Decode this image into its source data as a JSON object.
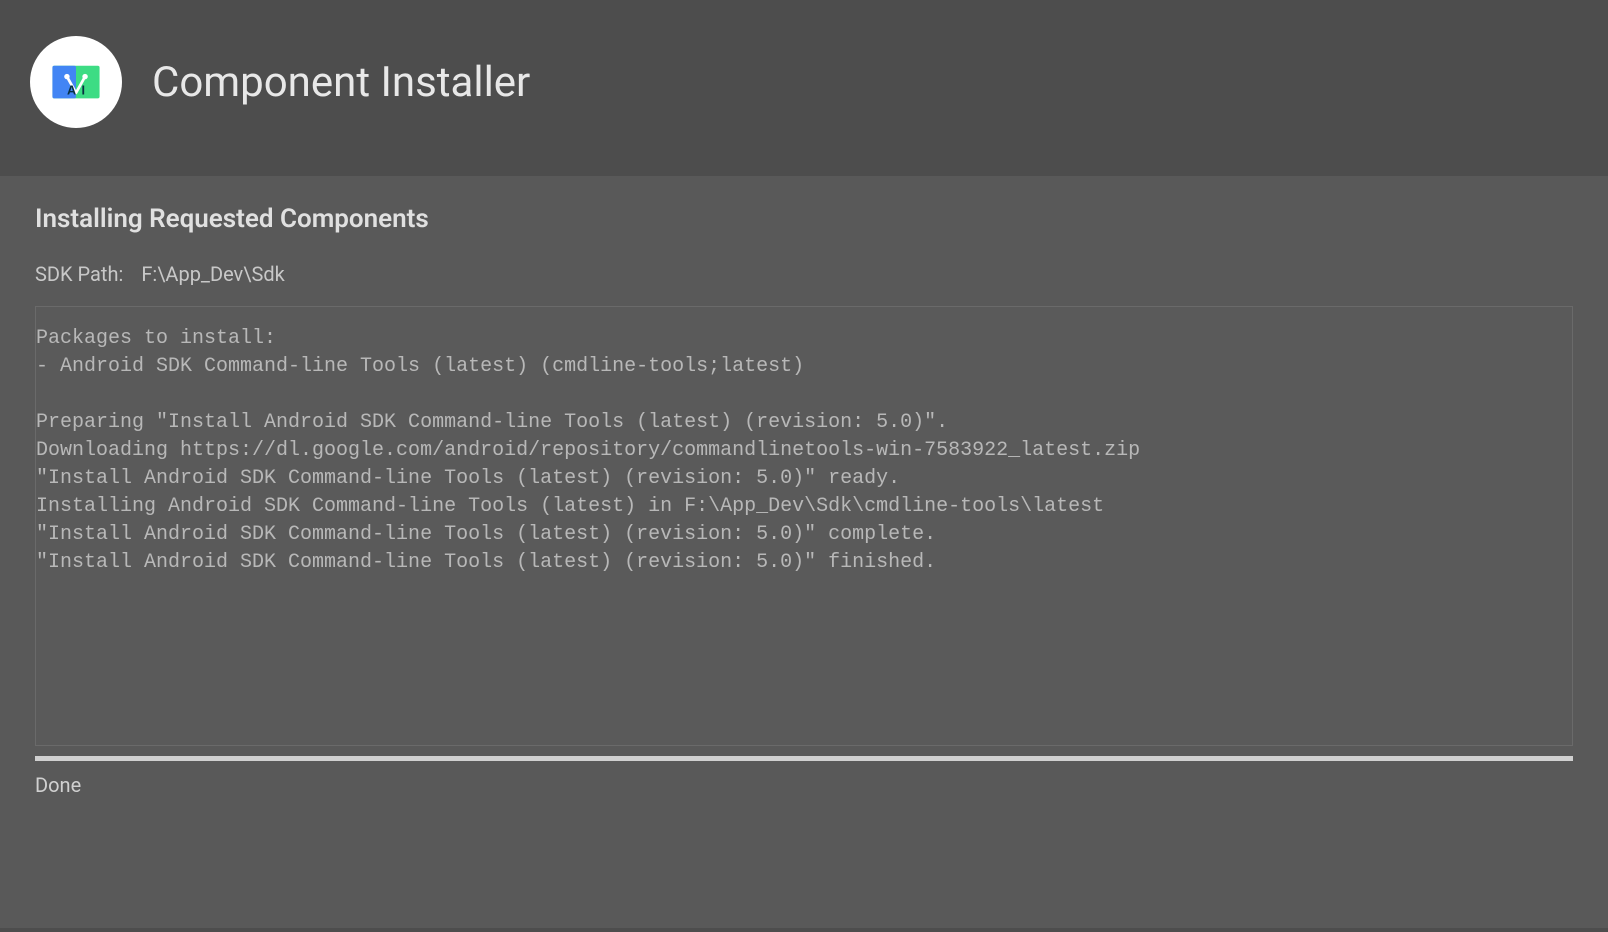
{
  "header": {
    "title": "Component Installer"
  },
  "section": {
    "title": "Installing Requested Components",
    "sdk_path_label": "SDK Path:",
    "sdk_path_value": "F:\\App_Dev\\Sdk"
  },
  "log": "Packages to install:\n- Android SDK Command-line Tools (latest) (cmdline-tools;latest)\n\nPreparing \"Install Android SDK Command-line Tools (latest) (revision: 5.0)\".\nDownloading https://dl.google.com/android/repository/commandlinetools-win-7583922_latest.zip\n\"Install Android SDK Command-line Tools (latest) (revision: 5.0)\" ready.\nInstalling Android SDK Command-line Tools (latest) in F:\\App_Dev\\Sdk\\cmdline-tools\\latest\n\"Install Android SDK Command-line Tools (latest) (revision: 5.0)\" complete.\n\"Install Android SDK Command-line Tools (latest) (revision: 5.0)\" finished.",
  "status": "Done"
}
